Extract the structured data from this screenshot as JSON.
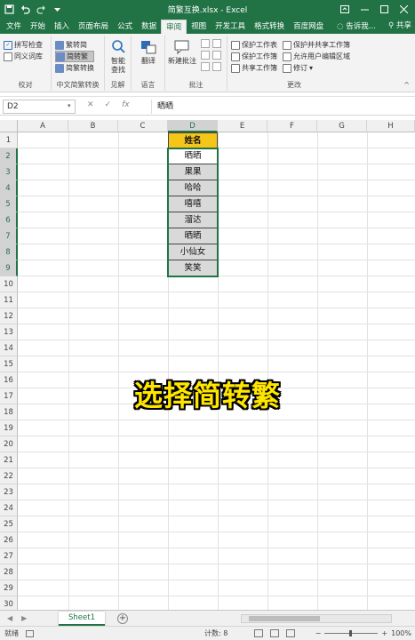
{
  "window": {
    "title": "简繁互换.xlsx - Excel",
    "quick_access": [
      "save-icon",
      "undo-icon",
      "redo-icon",
      "customize-icon"
    ],
    "controls": [
      "ribbon-options-icon",
      "minimize-icon",
      "maximize-icon",
      "close-icon"
    ]
  },
  "tabs": [
    "文件",
    "开始",
    "插入",
    "页面布局",
    "公式",
    "数据",
    "审阅",
    "视图",
    "开发工具",
    "格式转换",
    "百度网盘"
  ],
  "active_tab": "审阅",
  "tell_me": "告诉我...",
  "share": "共享",
  "ribbon": {
    "proofing": {
      "spell_check": "拼写检查",
      "thesaurus": "同义词库",
      "label": "校对"
    },
    "chinese_conversion": {
      "to_traditional": "繁转简",
      "to_simplified": "简转繁",
      "convert": "简繁转换",
      "label": "中文简繁转换"
    },
    "insights": {
      "smart_lookup_line1": "智能",
      "smart_lookup_line2": "查找",
      "label": "见解"
    },
    "language": {
      "translate": "翻译",
      "label": "语言"
    },
    "comments": {
      "new_comment": "新建批注",
      "label": "批注"
    },
    "changes": {
      "protect_sheet": "保护工作表",
      "protect_workbook": "保护工作簿",
      "share_workbook": "共享工作簿",
      "protect_share": "保护并共享工作簿",
      "allow_edit": "允许用户编辑区域",
      "track_changes": "修订",
      "label": "更改"
    }
  },
  "formula_bar": {
    "name_box": "D2",
    "content": "晒晒"
  },
  "columns": [
    "A",
    "B",
    "C",
    "D",
    "E",
    "F",
    "G",
    "H"
  ],
  "rows": [
    "1",
    "2",
    "3",
    "4",
    "5",
    "6",
    "7",
    "8",
    "9",
    "10",
    "11",
    "12",
    "13",
    "14",
    "15",
    "16",
    "17",
    "18",
    "19",
    "20",
    "21",
    "22",
    "23",
    "24",
    "25",
    "26",
    "27",
    "28",
    "29",
    "30"
  ],
  "table": {
    "header": "姓名",
    "values": [
      "晒晒",
      "果果",
      "哈哈",
      "嘻嘻",
      "溜达",
      "晒晒",
      "小仙女",
      "笑笑"
    ]
  },
  "caption": "选择简转繁",
  "sheet": {
    "name": "Sheet1"
  },
  "status": {
    "ready": "就绪",
    "count": "计数: 8",
    "zoom": "100%"
  }
}
